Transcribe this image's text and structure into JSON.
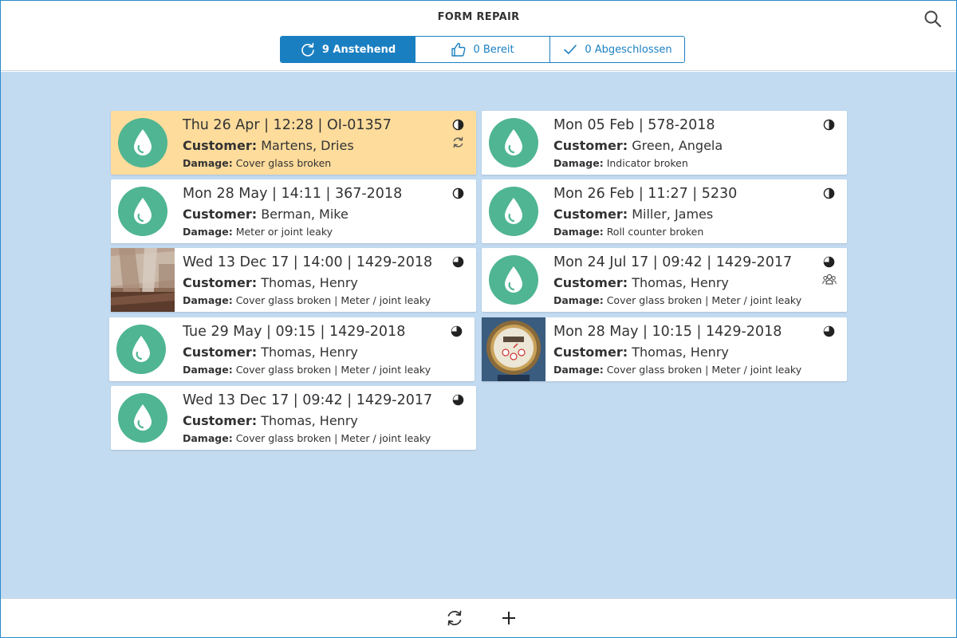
{
  "header": {
    "title": "FORM REPAIR",
    "search_icon": "search-icon"
  },
  "tabs": [
    {
      "label": "9 Anstehend",
      "icon": "refresh-icon",
      "active": true
    },
    {
      "label": "0 Bereit",
      "icon": "thumbs-up-icon",
      "active": false
    },
    {
      "label": "0 Abgeschlossen",
      "icon": "check-icon",
      "active": false
    }
  ],
  "labels": {
    "customer": "Customer:",
    "damage": "Damage:"
  },
  "cards": [
    {
      "title": "Thu 26 Apr | 12:28 | OI-01357",
      "customer": "Martens, Dries",
      "damage": "Cover glass broken",
      "status": "half",
      "extra_icon": "sync-icon",
      "thumb": "drop",
      "highlight": true
    },
    {
      "title": "Mon 05 Feb | 578-2018",
      "customer": "Green, Angela",
      "damage": "Indicator broken",
      "status": "half",
      "thumb": "drop"
    },
    {
      "title": "Mon 28 May | 14:11 | 367-2018",
      "customer": "Berman, Mike",
      "damage": "Meter or joint leaky",
      "status": "half",
      "thumb": "drop"
    },
    {
      "title": "Mon 26 Feb | 11:27 | 5230",
      "customer": "Miller, James",
      "damage": "Roll counter broken",
      "status": "half",
      "thumb": "drop"
    },
    {
      "title": "Wed 13 Dec 17 | 14:00 | 1429-2018",
      "customer": "Thomas, Henry",
      "damage": "Cover glass broken | Meter / joint leaky",
      "status": "three-quarter",
      "thumb": "photo-pipe"
    },
    {
      "title": "Mon 24 Jul 17 | 09:42 | 1429-2017",
      "customer": "Thomas, Henry",
      "damage": "Cover glass broken | Meter / joint leaky",
      "status": "three-quarter",
      "extra_icon": "group-icon",
      "thumb": "drop"
    },
    {
      "title": "Tue 29 May | 09:15 | 1429-2018",
      "customer": "Thomas, Henry",
      "damage": "Cover glass broken | Meter / joint leaky",
      "status": "three-quarter",
      "thumb": "drop"
    },
    {
      "title": "Mon 28 May | 10:15 | 1429-2018",
      "customer": "Thomas, Henry",
      "damage": "Cover glass broken | Meter / joint leaky",
      "status": "three-quarter",
      "thumb": "photo-meter"
    },
    {
      "title": "Wed 13 Dec 17 | 09:42 | 1429-2017",
      "customer": "Thomas, Henry",
      "damage": "Cover glass broken | Meter / joint leaky",
      "status": "three-quarter",
      "thumb": "drop"
    }
  ],
  "footer": {
    "refresh_icon": "refresh-icon",
    "add_icon": "plus-icon"
  },
  "colors": {
    "accent": "#1a7fc1",
    "background": "#c2dbf1",
    "highlight": "#fddc9c",
    "drop": "#4fb592"
  }
}
